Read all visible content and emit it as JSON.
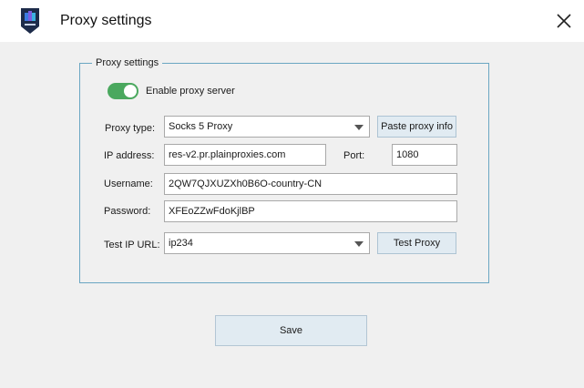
{
  "window": {
    "title": "Proxy settings"
  },
  "group": {
    "label": "Proxy settings"
  },
  "enable_proxy": {
    "label": "Enable proxy server",
    "enabled": true
  },
  "proxy_type": {
    "label": "Proxy type:",
    "value": "Socks 5 Proxy"
  },
  "paste_button": {
    "label": "Paste proxy info"
  },
  "ip_address": {
    "label": "IP address:",
    "value": "res-v2.pr.plainproxies.com"
  },
  "port": {
    "label": "Port:",
    "value": "1080"
  },
  "username": {
    "label": "Username:",
    "value": "2QW7QJXUZXh0B6O-country-CN"
  },
  "password": {
    "label": "Password:",
    "value": "XFEoZZwFdoKjlBP"
  },
  "test_ip_url": {
    "label": "Test IP URL:",
    "value": "ip234"
  },
  "test_button": {
    "label": "Test Proxy"
  },
  "save_button": {
    "label": "Save"
  },
  "icons": {
    "app": "app-logo-icon",
    "close": "close-icon",
    "dropdown": "chevron-down-icon"
  },
  "colors": {
    "toggle_on": "#4aa85e",
    "group_border": "#6aa6c2",
    "button_bg": "#e1ebf2"
  }
}
